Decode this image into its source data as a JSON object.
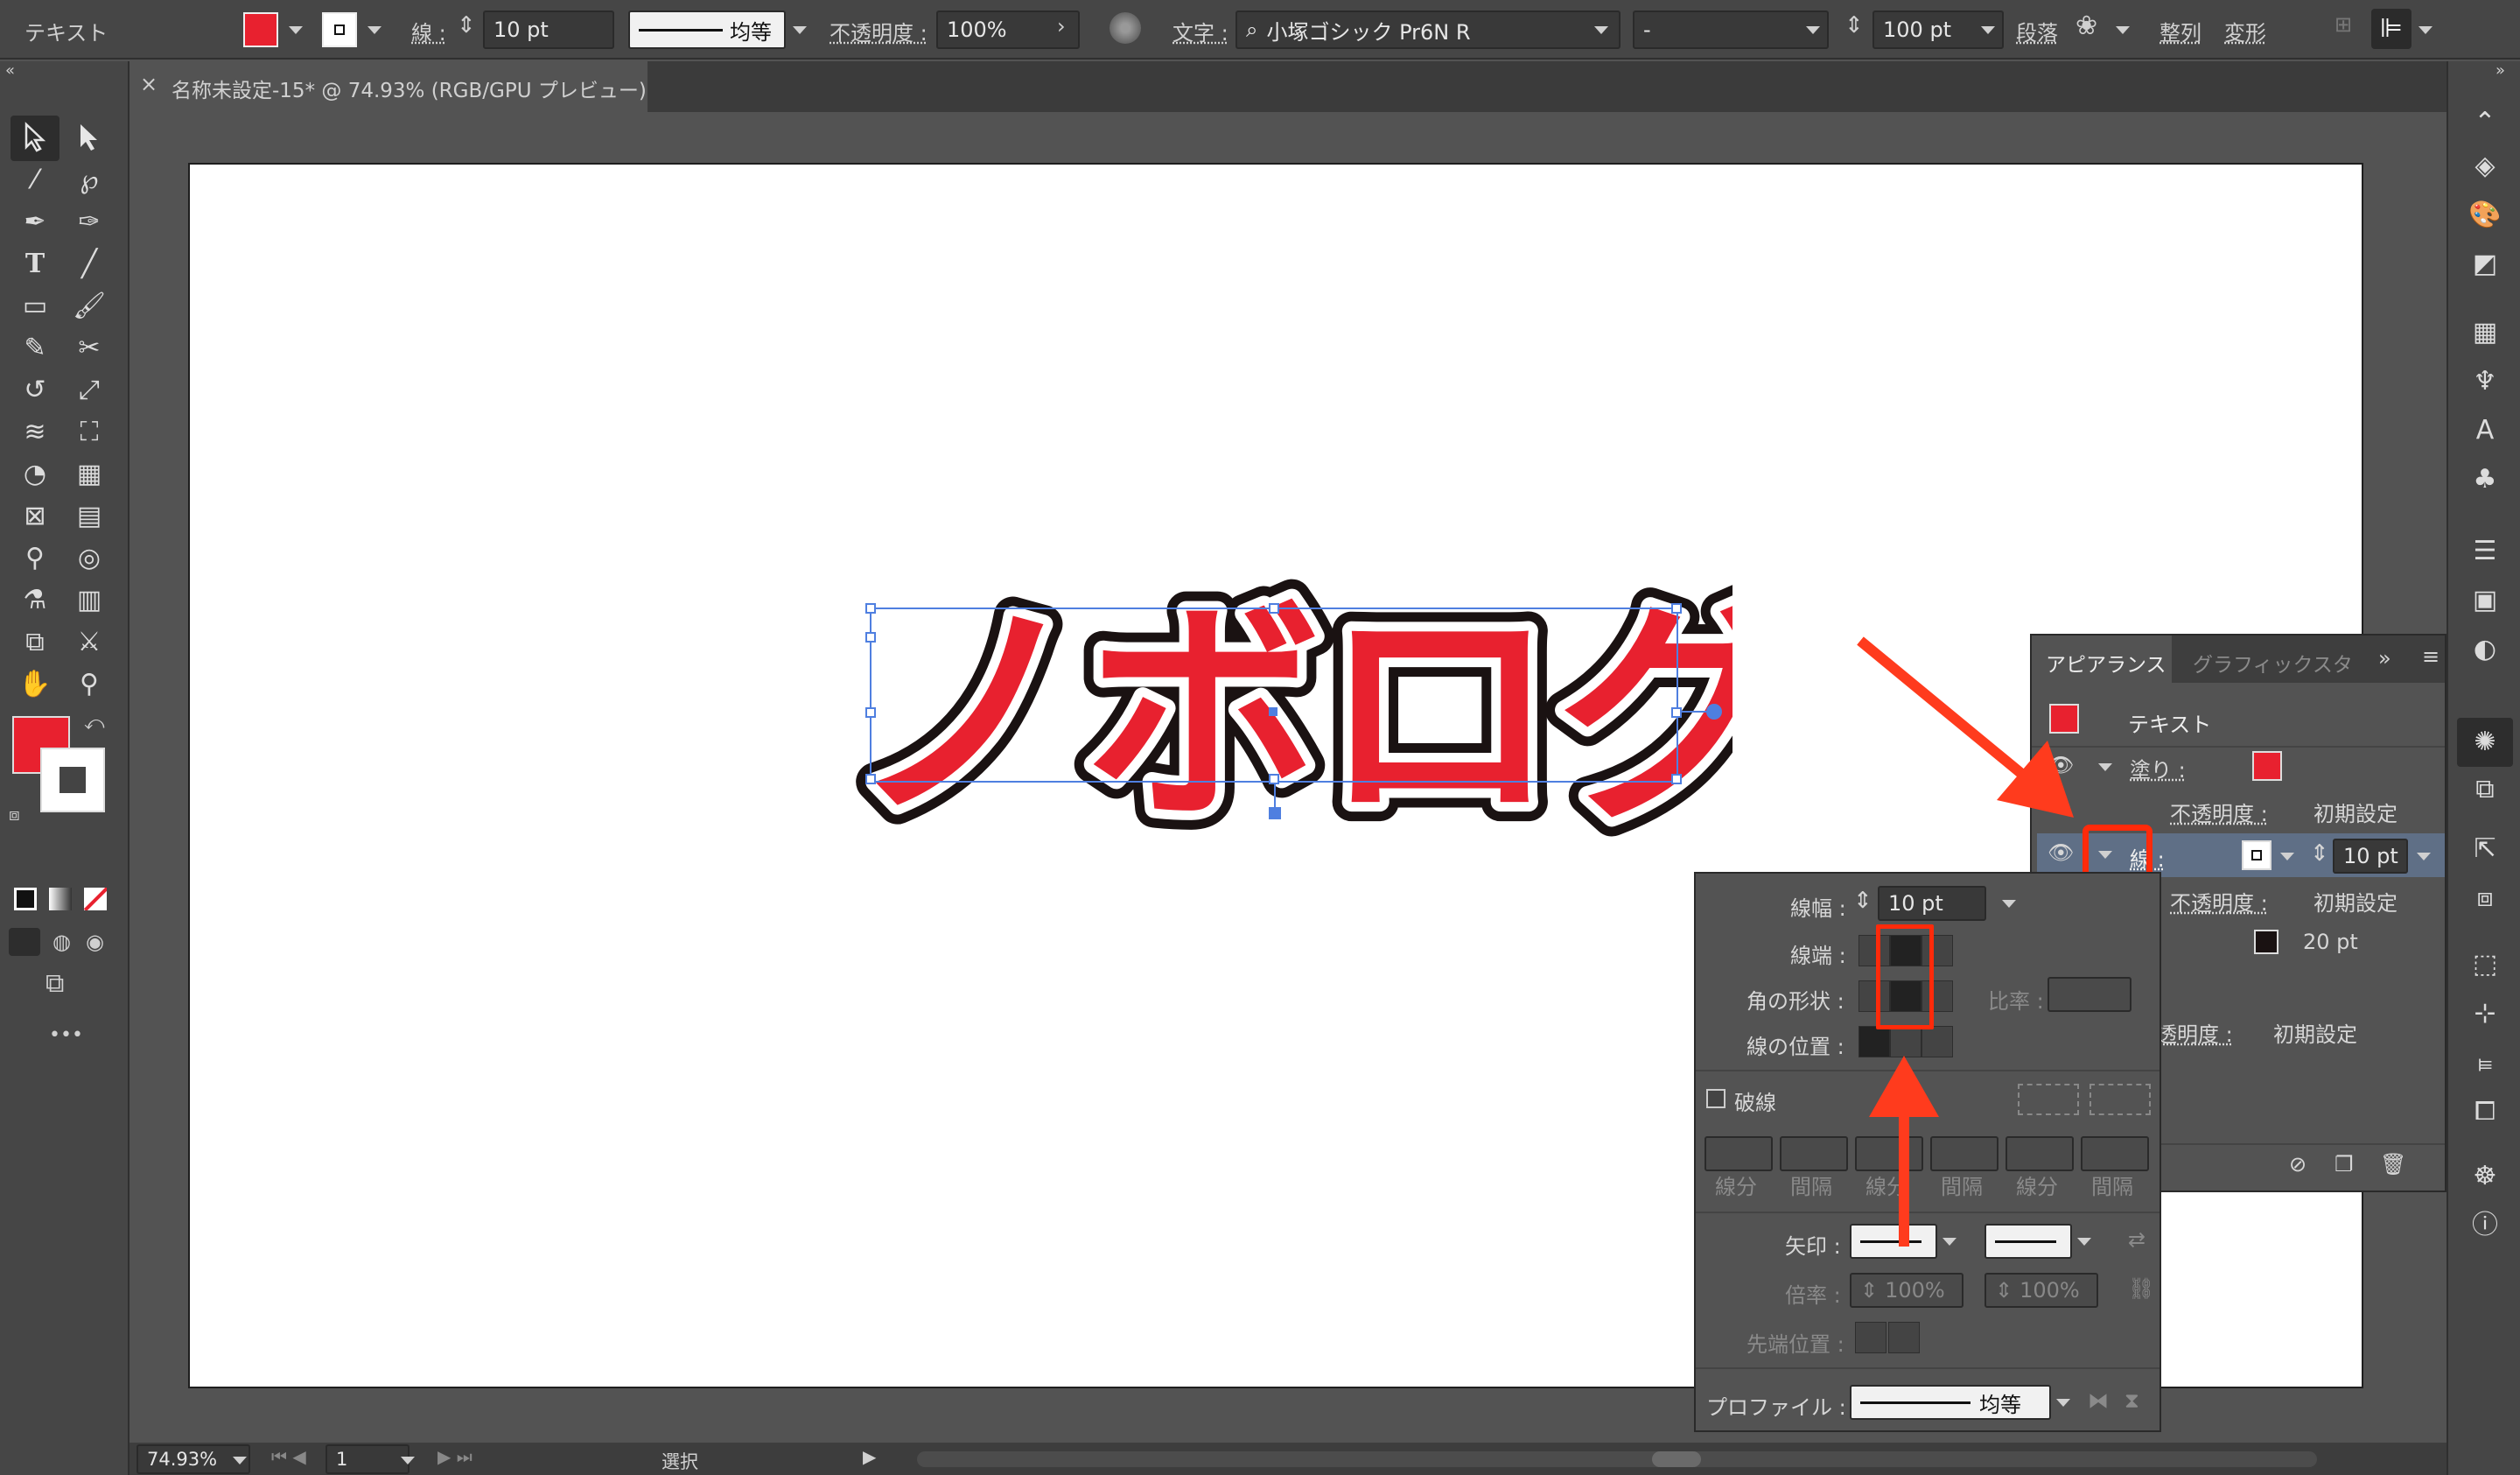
{
  "control_bar": {
    "selection_type": "テキスト",
    "stroke_label": "線 :",
    "stroke_weight": "10 pt",
    "stroke_profile": "均等",
    "opacity_label": "不透明度 :",
    "opacity_value": "100%",
    "char_label": "文字 :",
    "font_family": "小塚ゴシック Pr6N R",
    "font_style": "-",
    "font_size": "100 pt",
    "paragraph": "段落",
    "align": "整列",
    "transform": "変形"
  },
  "document": {
    "tab_title": "名称未設定-15* @ 74.93% (RGB/GPU プレビュー)",
    "close": "×"
  },
  "artwork": {
    "text": "ノボログ",
    "fill_color": "#e8212f",
    "stroke_inner": "#ffffff",
    "stroke_outer": "#1a1212"
  },
  "appearance_panel": {
    "tab_active": "アピアランス",
    "tab_inactive": "グラフィックスタ",
    "collapse": "»",
    "object_type": "テキスト",
    "fill_label": "塗り :",
    "opacity_label": "不透明度 :",
    "default_label": "初期設定",
    "stroke_label": "線 :",
    "stroke_weight": "10 pt",
    "stroke2_weight": "20 pt",
    "trailing_opacity_label": "透明度 :",
    "trailing_default": "初期設定",
    "fill_color": "#e8212f",
    "stroke2_color": "#1a1212"
  },
  "stroke_panel": {
    "weight_label": "線幅 :",
    "weight_value": "10 pt",
    "cap_label": "線端 :",
    "corner_label": "角の形状 :",
    "limit_label": "比率 :",
    "align_label": "線の位置 :",
    "dashed_label": "破線",
    "dash_labels": [
      "線分",
      "間隔",
      "線分",
      "間隔",
      "線分",
      "間隔"
    ],
    "arrow_label": "矢印 :",
    "scale_label": "倍率 :",
    "scale_start": "100%",
    "scale_end": "100%",
    "tip_label": "先端位置 :",
    "profile_label": "プロファイル :",
    "profile_value": "均等"
  },
  "status_bar": {
    "zoom": "74.93%",
    "artboard_num": "1",
    "tool": "選択"
  },
  "toolbox": {
    "fill_color": "#e8212f",
    "stroke_color": "#ffffff",
    "more": "•••"
  },
  "annotations": {
    "arrow_color": "#ff3b1d"
  }
}
